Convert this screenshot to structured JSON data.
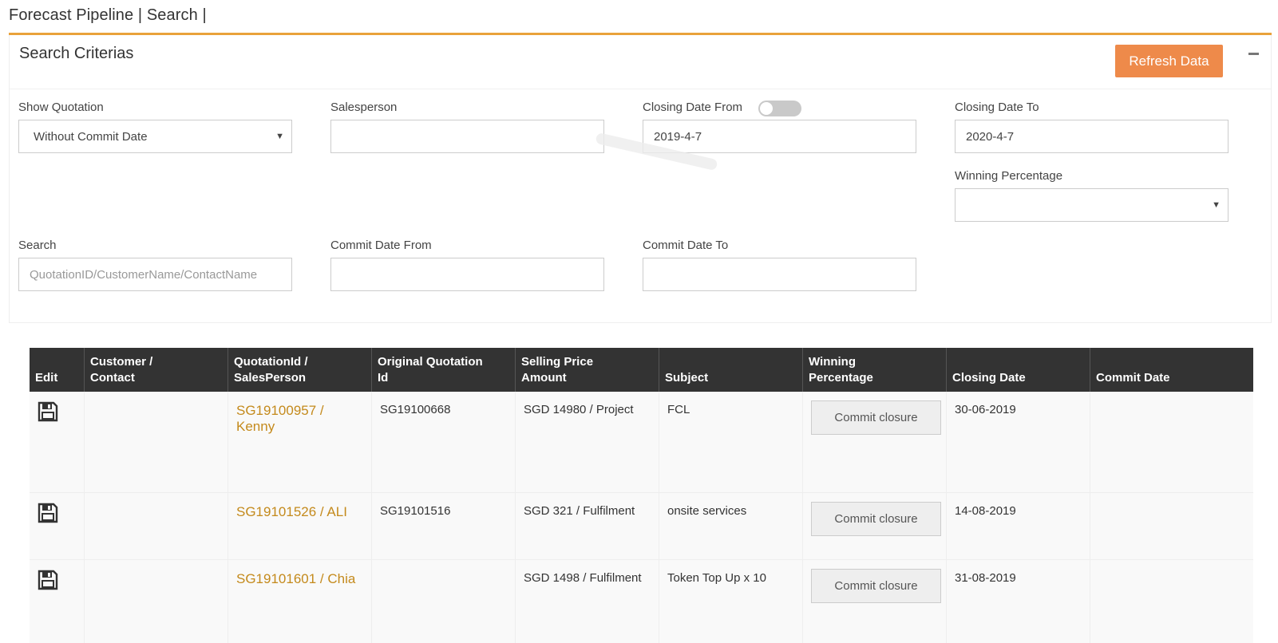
{
  "page": {
    "title": "Forecast Pipeline | Search |"
  },
  "colors": {
    "accent": "#e9a23b",
    "button": "#ee8a4a",
    "table_header": "#333333",
    "link": "#c48a1c"
  },
  "search_panel": {
    "title": "Search Criterias",
    "refresh_label": "Refresh Data",
    "collapse_icon": "minus-icon",
    "show_quotation": {
      "label": "Show Quotation",
      "value": "Without Commit Date"
    },
    "salesperson": {
      "label": "Salesperson",
      "value": ""
    },
    "closing_date_from": {
      "label": "Closing Date From",
      "value": "2019-4-7",
      "toggle_on": false
    },
    "closing_date_to": {
      "label": "Closing Date To",
      "value": "2020-4-7"
    },
    "winning_percentage": {
      "label": "Winning Percentage",
      "value": ""
    },
    "search": {
      "label": "Search",
      "placeholder": "QuotationID/CustomerName/ContactName"
    },
    "commit_date_from": {
      "label": "Commit Date From",
      "value": ""
    },
    "commit_date_to": {
      "label": "Commit Date To",
      "value": ""
    }
  },
  "table": {
    "headers": [
      "Edit",
      "Customer /\nContact",
      "QuotationId /\nSalesPerson",
      "Original Quotation\nId",
      "Selling Price\nAmount",
      "Subject",
      "Winning\nPercentage",
      "Closing Date",
      "Commit Date"
    ],
    "rows": [
      {
        "edit_icon": "floppy-disk-icon",
        "customer": "",
        "quotation": "SG19100957 / Kenny",
        "original_id": "SG19100668",
        "price": "SGD 14980 / Project",
        "subject": "FCL",
        "commit_label": "Commit closure",
        "closing_date": "30-06-2019",
        "commit_date": ""
      },
      {
        "edit_icon": "floppy-disk-icon",
        "customer": "",
        "quotation": "SG19101526 / ALI",
        "original_id": "SG19101516",
        "price": "SGD 321 / Fulfilment",
        "subject": "onsite services",
        "commit_label": "Commit closure",
        "closing_date": "14-08-2019",
        "commit_date": ""
      },
      {
        "edit_icon": "floppy-disk-icon",
        "customer": "",
        "quotation": "SG19101601 / Chia",
        "original_id": "",
        "price": "SGD 1498 / Fulfilment",
        "subject": "Token Top Up x 10",
        "commit_label": "Commit closure",
        "closing_date": "31-08-2019",
        "commit_date": ""
      }
    ]
  }
}
